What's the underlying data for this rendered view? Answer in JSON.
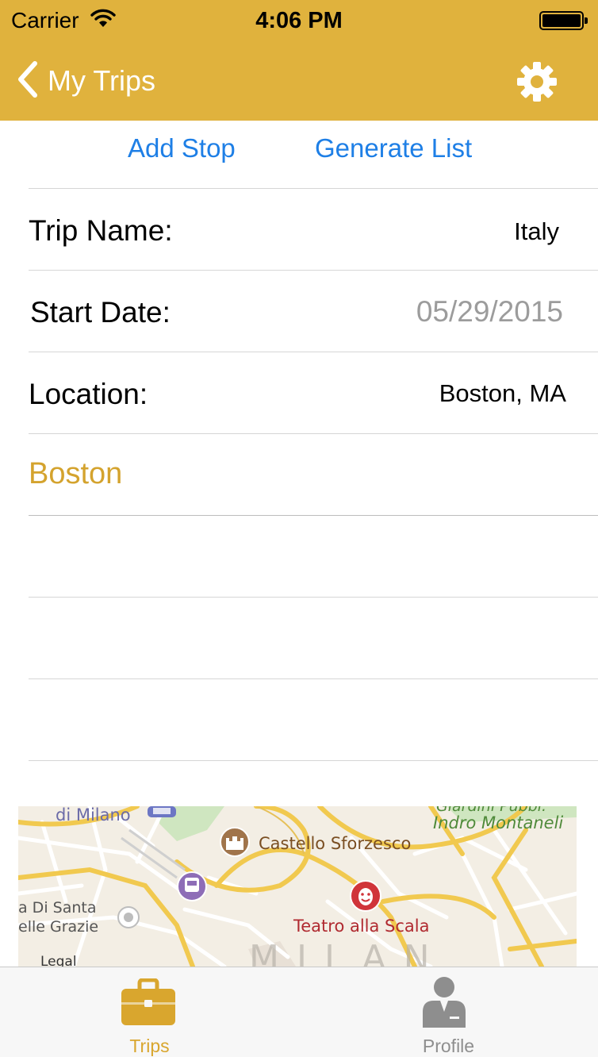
{
  "status_bar": {
    "carrier": "Carrier",
    "time": "4:06 PM"
  },
  "nav": {
    "back_label": "My Trips"
  },
  "actions": {
    "add_stop": "Add Stop",
    "generate_list": "Generate List"
  },
  "form": {
    "trip_name_label": "Trip Name:",
    "trip_name_value": "Italy",
    "start_date_label": "Start Date:",
    "start_date_value": "05/29/2015",
    "location_label": "Location:",
    "location_value": "Boston, MA"
  },
  "stops": [
    {
      "name": "Boston"
    }
  ],
  "map": {
    "labels": {
      "di_milano": "di Milano",
      "castello": "Castello Sforzesco",
      "giardini": "Giardini Pubbl.",
      "montanelli": "Indro Montaneli",
      "santa": "a Di Santa",
      "grazie": "elle Grazie",
      "teatro": "Teatro alla Scala",
      "legal": "Legal",
      "city": "MILAN"
    }
  },
  "tabs": [
    {
      "label": "Trips",
      "active": true
    },
    {
      "label": "Profile",
      "active": false
    }
  ],
  "colors": {
    "header": "#E0B23D",
    "accent": "#D4A32E",
    "link": "#1E7FE6",
    "inactive": "#8E8E8E"
  }
}
